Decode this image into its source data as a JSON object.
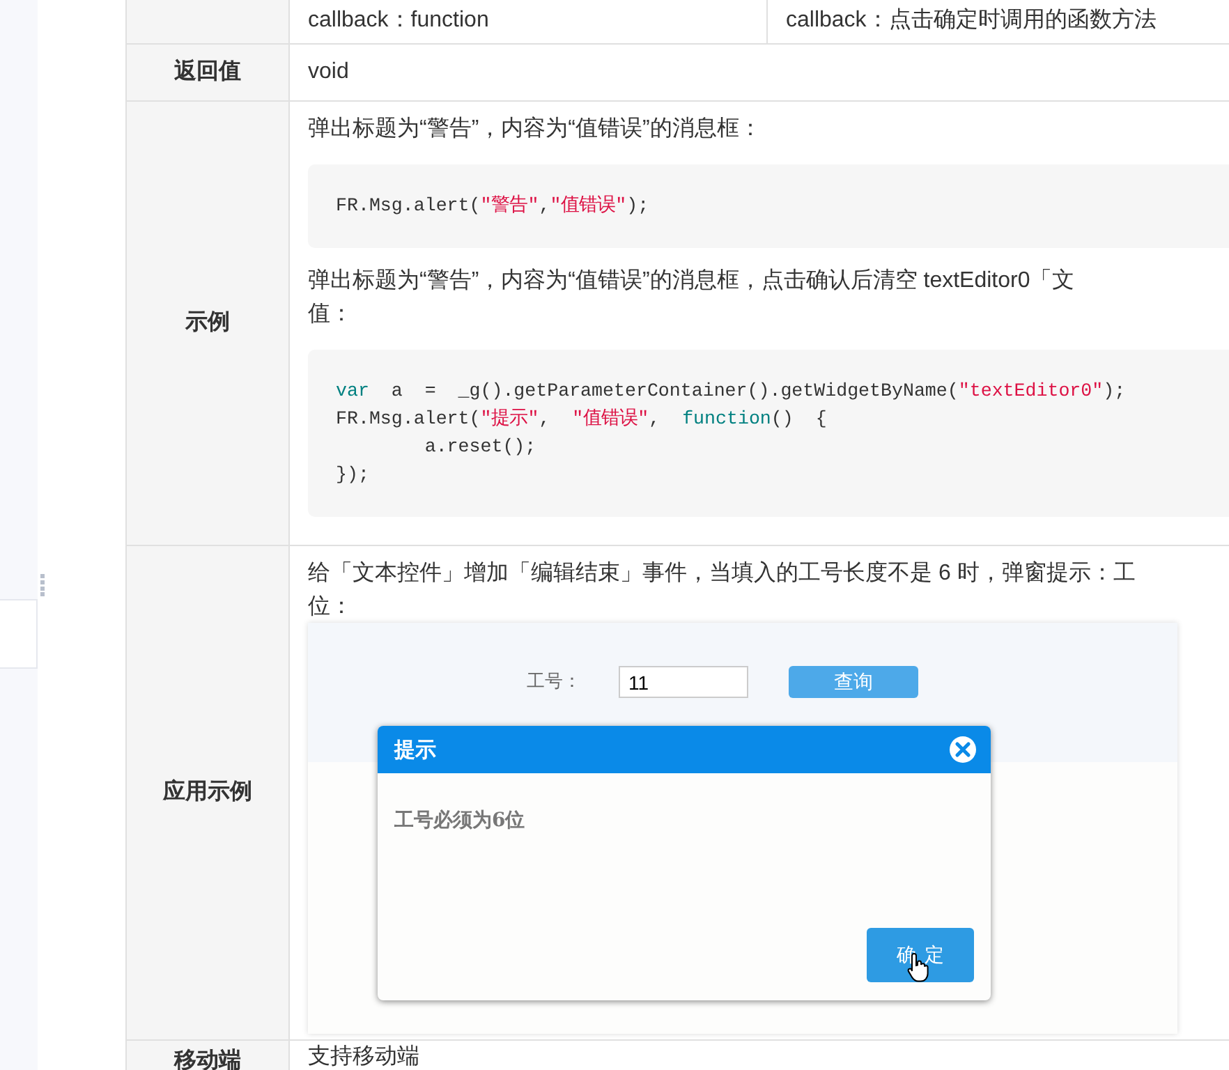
{
  "rows": [
    {
      "kind": "params",
      "cells": [
        "callback：function",
        "callback：点击确定时调用的函数方法"
      ]
    },
    {
      "kind": "text",
      "label": "返回值",
      "text": "void"
    },
    {
      "kind": "examples",
      "label": "示例",
      "blocks": [
        {
          "kind": "para",
          "lines": [
            "弹出标题为“警告”，内容为“值错误”的消息框："
          ]
        },
        {
          "kind": "code",
          "lines": [
            [
              {
                "kind": "plain",
                "text": "FR.Msg.alert("
              },
              {
                "kind": "string",
                "text": "\"警告\""
              },
              {
                "kind": "plain",
                "text": ","
              },
              {
                "kind": "string",
                "text": "\"值错误\""
              },
              {
                "kind": "plain",
                "text": ");"
              }
            ]
          ]
        },
        {
          "kind": "para",
          "lines": [
            "弹出标题为“警告”，内容为“值错误”的消息框，点击确认后清空 textEditor0「文",
            "值："
          ]
        },
        {
          "kind": "code",
          "lines": [
            [
              {
                "kind": "keyword",
                "text": "var"
              },
              {
                "kind": "plain",
                "text": "  a  =  _g().getParameterContainer().getWidgetByName("
              },
              {
                "kind": "string",
                "text": "\"textEditor0\""
              },
              {
                "kind": "plain",
                "text": ");"
              }
            ],
            [
              {
                "kind": "plain",
                "text": "FR.Msg.alert("
              },
              {
                "kind": "string",
                "text": "\"提示\""
              },
              {
                "kind": "plain",
                "text": ",  "
              },
              {
                "kind": "string",
                "text": "\"值错误\""
              },
              {
                "kind": "plain",
                "text": ",  "
              },
              {
                "kind": "keyword",
                "text": "function"
              },
              {
                "kind": "plain",
                "text": "()  {"
              }
            ],
            [
              {
                "kind": "plain",
                "text": "        a.reset();"
              }
            ],
            [
              {
                "kind": "plain",
                "text": "});"
              }
            ]
          ]
        }
      ]
    },
    {
      "kind": "examples",
      "label": "应用示例",
      "blocks": [
        {
          "kind": "para",
          "lines": [
            "给「文本控件」增加「编辑结束」事件，当填入的工号长度不是 6 时，弹窗提示：工",
            "位："
          ]
        },
        {
          "kind": "demo",
          "field_label": "工号：",
          "field_value": "11",
          "query_button": "查询",
          "dialog": {
            "title": "提示",
            "message": "工号必须为6位",
            "ok_button": "确定"
          }
        }
      ]
    },
    {
      "kind": "text",
      "label": "移动端",
      "text": "支持移动端"
    }
  ]
}
